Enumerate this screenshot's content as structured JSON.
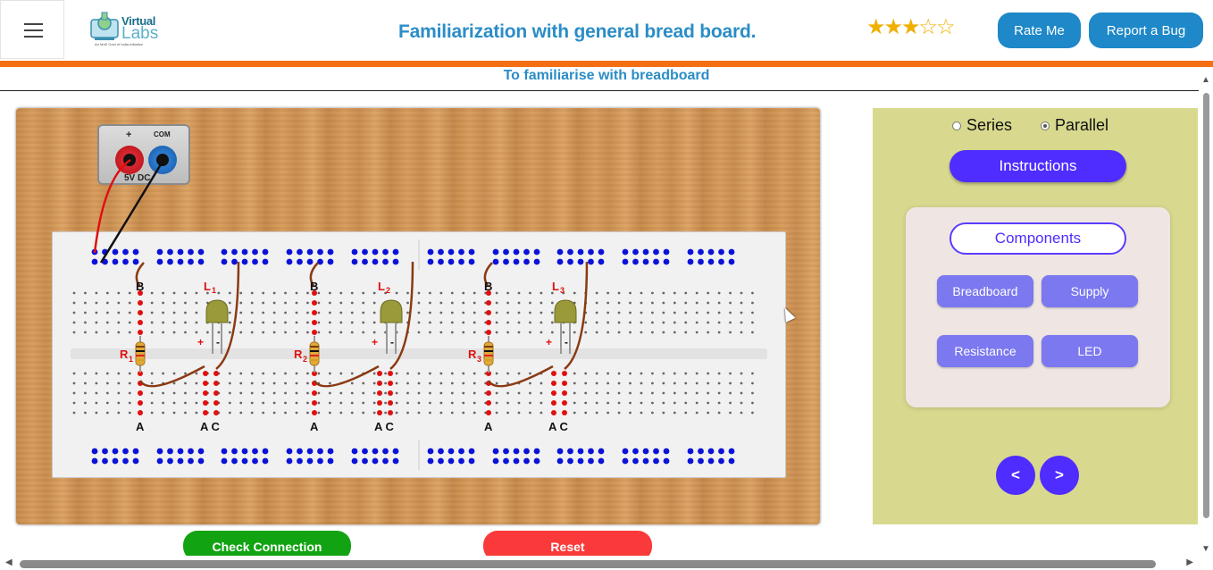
{
  "header": {
    "menu_icon": "hamburger-icon",
    "logo": {
      "line1": "Virtual",
      "line2": "Labs",
      "tagline": "An MoE Govt of India Initiative"
    },
    "title": "Familiarization with general bread board.",
    "rating": {
      "value": 3,
      "max": 5
    },
    "rate_label": "Rate Me",
    "bug_label": "Report a Bug",
    "brand_color": "#f36f12",
    "accent_color": "#1e88c8"
  },
  "subtitle": "To familiarise with breadboard",
  "simulator": {
    "supply": {
      "plus": "+",
      "com": "COM",
      "label": "5V DC"
    },
    "groups": [
      {
        "top_label": "B",
        "resistor": "R",
        "resistor_sub": "1",
        "led": "L",
        "led_sub": "1",
        "plus": "+",
        "minus": "-",
        "bottom_a": "A",
        "bottom_ac": "A C"
      },
      {
        "top_label": "B",
        "resistor": "R",
        "resistor_sub": "2",
        "led": "L",
        "led_sub": "2",
        "plus": "+",
        "minus": "-",
        "bottom_a": "A",
        "bottom_ac": "A C"
      },
      {
        "top_label": "B",
        "resistor": "R",
        "resistor_sub": "3",
        "led": "L",
        "led_sub": "3",
        "plus": "+",
        "minus": "-",
        "bottom_a": "A",
        "bottom_ac": "A C"
      }
    ],
    "check_label": "Check Connection",
    "reset_label": "Reset",
    "check_color": "#12a312",
    "reset_color": "#fa3a3a"
  },
  "panel": {
    "mode_options": [
      "Series",
      "Parallel"
    ],
    "mode_selected": "Parallel",
    "instructions_label": "Instructions",
    "components_title": "Components",
    "components": [
      "Breadboard",
      "Supply",
      "Resistance",
      "LED"
    ],
    "prev_label": "<",
    "next_label": ">",
    "bg_color": "#d8d98e",
    "accent": "#4f2cff"
  }
}
